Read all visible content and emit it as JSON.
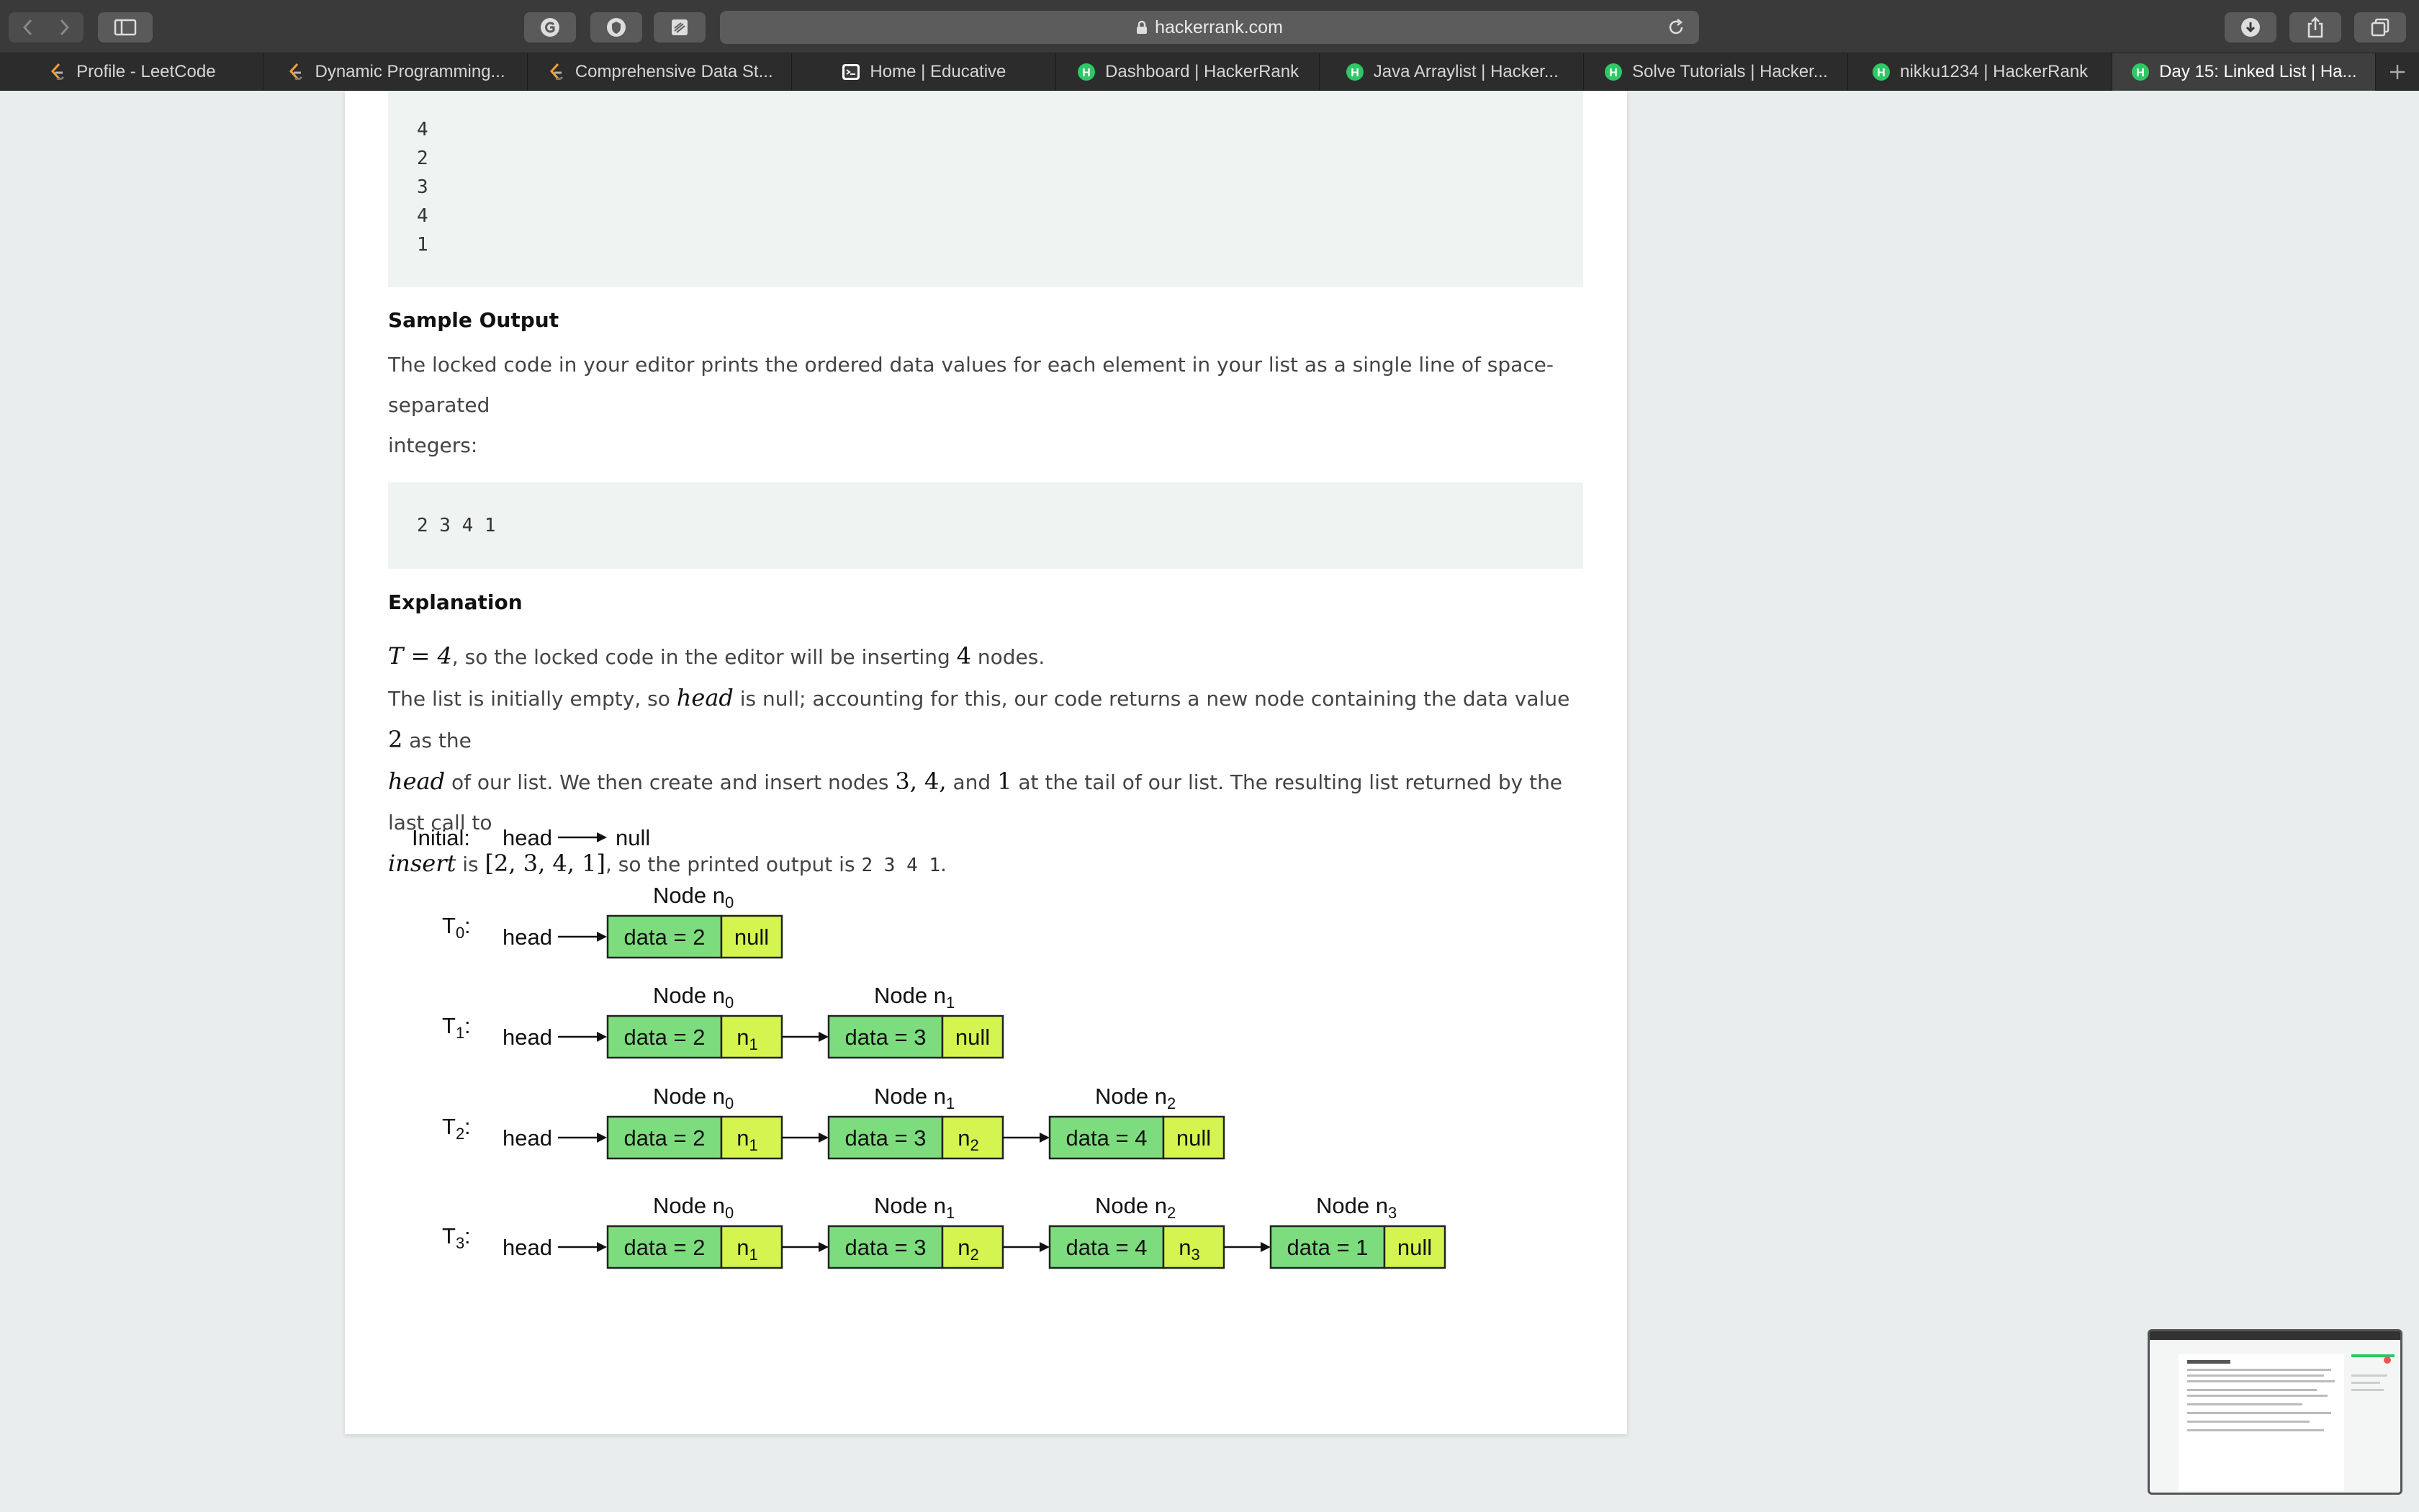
{
  "browser": {
    "url": "hackerrank.com",
    "tabs": [
      {
        "label": "Profile - LeetCode",
        "icon": "leetcode-icon"
      },
      {
        "label": "Dynamic Programming...",
        "icon": "leetcode-icon"
      },
      {
        "label": "Comprehensive Data St...",
        "icon": "leetcode-icon"
      },
      {
        "label": "Home | Educative",
        "icon": "educative-icon"
      },
      {
        "label": "Dashboard | HackerRank",
        "icon": "hackerrank-icon"
      },
      {
        "label": "Java Arraylist | Hacker...",
        "icon": "hackerrank-icon"
      },
      {
        "label": "Solve Tutorials | Hacker...",
        "icon": "hackerrank-icon"
      },
      {
        "label": "nikku1234 | HackerRank",
        "icon": "hackerrank-icon"
      },
      {
        "label": "Day 15: Linked List | Ha...",
        "icon": "hackerrank-icon"
      }
    ],
    "active_tab": 8,
    "colors": {
      "hackerrank_green": "#2ec866",
      "toolbar": "#3a3a3a"
    }
  },
  "problem": {
    "sample_input_lines": [
      "4",
      "2",
      "3",
      "4",
      "1"
    ],
    "sample_output_heading": "Sample Output",
    "sample_output_desc_1": "The locked code in your editor prints the ordered data values for each element in your list as a single line of space-separated",
    "sample_output_desc_2": "integers:",
    "sample_output": "2 3 4 1",
    "explanation_heading": "Explanation",
    "exp": {
      "l1_math": "T = 4",
      "l1_a": ", so the locked code in the editor will be inserting ",
      "l1_math2": "4",
      "l1_b": " nodes.",
      "l2_a": "The list is initially empty, so ",
      "l2_math_head": "head",
      "l2_b": " is null; accounting for this, our code returns a new node containing the data value ",
      "l2_math_2": "2",
      "l2_c": " as the",
      "l3_math_head": "head",
      "l3_a": " of our list. We then create and insert nodes ",
      "l3_math_nodes": "3, 4,",
      "l3_b": " and ",
      "l3_math_1": "1",
      "l3_c": " at the tail of our list. The resulting list returned by the last call to",
      "l4_math_insert": "insert",
      "l4_a": " is ",
      "l4_math_list": "[2, 3, 4, 1]",
      "l4_b": ", so the printed output is ",
      "l4_mono": "2 3 4 1",
      "l4_c": "."
    }
  },
  "diagram": {
    "initial_label": "Initial:",
    "head": "head",
    "null": "null",
    "rows": [
      {
        "label_main": "T",
        "label_sub": "0",
        "nodes": [
          {
            "name": "n",
            "sub": "0",
            "data": "data = 2",
            "next": "null"
          }
        ]
      },
      {
        "label_main": "T",
        "label_sub": "1",
        "nodes": [
          {
            "name": "n",
            "sub": "0",
            "data": "data = 2",
            "next": "n1"
          },
          {
            "name": "n",
            "sub": "1",
            "data": "data = 3",
            "next": "null"
          }
        ]
      },
      {
        "label_main": "T",
        "label_sub": "2",
        "nodes": [
          {
            "name": "n",
            "sub": "0",
            "data": "data = 2",
            "next": "n1"
          },
          {
            "name": "n",
            "sub": "1",
            "data": "data = 3",
            "next": "n2"
          },
          {
            "name": "n",
            "sub": "2",
            "data": "data = 4",
            "next": "null"
          }
        ]
      },
      {
        "label_main": "T",
        "label_sub": "3",
        "nodes": [
          {
            "name": "n",
            "sub": "0",
            "data": "data = 2",
            "next": "n1"
          },
          {
            "name": "n",
            "sub": "1",
            "data": "data = 3",
            "next": "n2"
          },
          {
            "name": "n",
            "sub": "2",
            "data": "data = 4",
            "next": "n3"
          },
          {
            "name": "n",
            "sub": "3",
            "data": "data = 1",
            "next": "null"
          }
        ]
      }
    ],
    "node_label": "Node",
    "colors": {
      "data_fill": "#7ddc7d",
      "next_fill": "#d4f54f",
      "stroke": "#222222"
    }
  }
}
